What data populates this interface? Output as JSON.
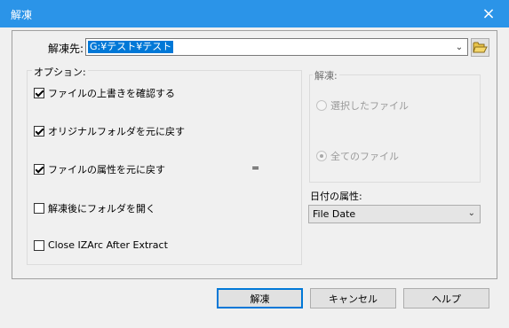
{
  "window": {
    "title": "解凍",
    "close_icon": "×"
  },
  "destination": {
    "label": "解凍先:",
    "value": "G:¥テスト¥テスト"
  },
  "options": {
    "label": "オプション:",
    "items": [
      {
        "label": "ファイルの上書きを確認する",
        "checked": true
      },
      {
        "label": "オリジナルフォルダを元に戻す",
        "checked": true
      },
      {
        "label": "ファイルの属性を元に戻す",
        "checked": true
      },
      {
        "label": "解凍後にフォルダを開く",
        "checked": false
      },
      {
        "label": "Close IZArc After Extract",
        "checked": false
      }
    ],
    "extra_mark": "="
  },
  "extract": {
    "label": "解凍:",
    "radios": [
      {
        "label": "選択したファイル",
        "selected": false
      },
      {
        "label": "全てのファイル",
        "selected": true
      }
    ]
  },
  "date_attr": {
    "label": "日付の属性:",
    "value": "File Date"
  },
  "buttons": {
    "ok": "解凍",
    "cancel": "キャンセル",
    "help": "ヘルプ"
  },
  "colors": {
    "titlebar": "#2b94e8",
    "selection": "#0078d7",
    "background": "#f0f0f0"
  }
}
